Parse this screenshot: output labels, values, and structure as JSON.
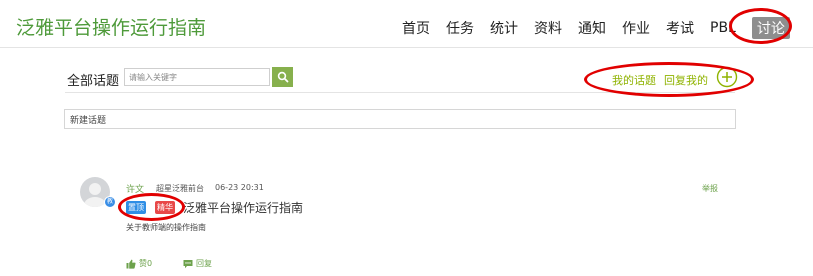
{
  "header": {
    "title": "泛雅平台操作运行指南",
    "nav": [
      "首页",
      "任务",
      "统计",
      "资料",
      "通知",
      "作业",
      "考试",
      "PBL",
      "讨论"
    ],
    "active_nav": "讨论"
  },
  "toolbar": {
    "all_topics_label": "全部话题",
    "search_placeholder": "请输入关键字",
    "search_icon": "search-icon",
    "my_topics": "我的话题",
    "reply_to_me": "回复我的",
    "add_icon": "plus-circle-icon"
  },
  "new_topic": {
    "label": "新建话题"
  },
  "post": {
    "author": "许文",
    "badge": "教",
    "source": "超星泛雅前台",
    "time": "06-23 20:31",
    "report": "举报",
    "tags": [
      "置顶",
      "精华"
    ],
    "title": "泛雅平台操作运行指南",
    "summary": "关于教师端的操作指南",
    "like_label": "赞0",
    "reply_label": "回复"
  },
  "colors": {
    "brand_green": "#4e9a3a",
    "link_green": "#8fb300",
    "search_button": "#87b04d",
    "active_nav_bg": "#8e8e8e",
    "pin_tag": "#2f8ee5",
    "hot_tag": "#e84848",
    "annotation_red": "#e10000"
  }
}
